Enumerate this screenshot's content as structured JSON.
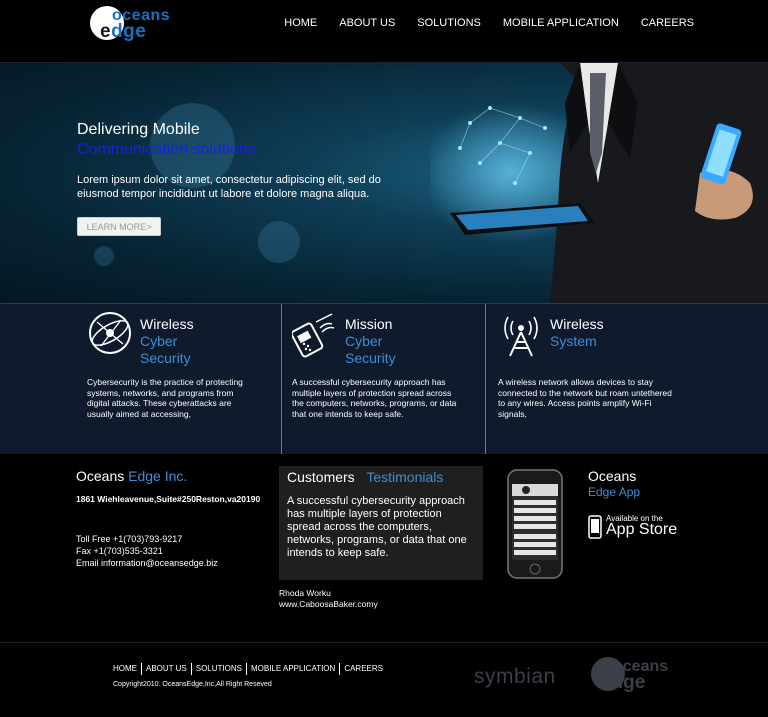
{
  "header": {
    "logo_top": "oceans",
    "logo_bottom_first": "e",
    "logo_bottom_rest": "dge",
    "nav": [
      "HOME",
      "ABOUT US",
      "SOLUTIONS",
      "MOBILE APPLICATION",
      "CAREERS"
    ]
  },
  "hero": {
    "title_line1": "Delivering Mobile",
    "title_line2": "Communication solutions",
    "body": "Lorem ipsum dolor sit amet, consectetur adipiscing elit, sed do eiusmod tempor incididunt ut labore et dolore magna aliqua.",
    "button_label": "LEARN MORE>"
  },
  "features": [
    {
      "title_white": "Wireless",
      "title_blue_1": "Cyber",
      "title_blue_2": "Security",
      "icon": "globe-icon",
      "text": "Cybersecurity is the practice of protecting systems, networks, and programs from digital attacks. These cyberattacks are usually aimed at accessing,"
    },
    {
      "title_white": "Mission",
      "title_blue_1": "Cyber",
      "title_blue_2": "Security",
      "icon": "phone-signal-icon",
      "text": "A successful cybersecurity approach has multiple layers of protection spread across the computers, networks, programs, or data that one intends to keep safe."
    },
    {
      "title_white": "Wireless",
      "title_blue_1": "System",
      "title_blue_2": "",
      "icon": "antenna-icon",
      "text": "A wireless network allows devices to stay connected to the network but roam untethered to any wires. Access points amplify Wi-Fi signals,"
    }
  ],
  "company": {
    "name_white": "Oceans",
    "name_blue": "Edge Inc.",
    "address": "1861 Wiehleavenue,Suite#250Reston,va20190",
    "toll_free": "Toll Free +1(703)793-9217",
    "fax": "Fax +1(703)535-3321",
    "email": "Email information@oceansedge.biz"
  },
  "testimonials": {
    "head_white": "Customers",
    "head_blue": "Testimonials",
    "body": "A successful cybersecurity approach has multiple layers of protection spread across the computers, networks, programs, or data that one intends to keep safe.",
    "author": "Rhoda Worku",
    "website": "www.CaboosaBaker.comy"
  },
  "app": {
    "name_white": "Oceans",
    "name_blue": "Edge App",
    "badge_small": "Available on the",
    "badge_big": "App Store"
  },
  "footer": {
    "nav": [
      "HOME",
      "ABOUT US",
      "SOLUTIONS",
      "MOBILE APPLICATION",
      "CAREERS"
    ],
    "copyright": "Copyright2010. OceansEdge,Inc,All Right Reseved",
    "partner": "symbian",
    "logo_top": "oceans",
    "logo_bottom": "edge"
  },
  "colors": {
    "accent_blue": "#3c8fd6",
    "hero_title_blue": "#1a1fe0",
    "feature_bg": "#0f1a2c"
  }
}
